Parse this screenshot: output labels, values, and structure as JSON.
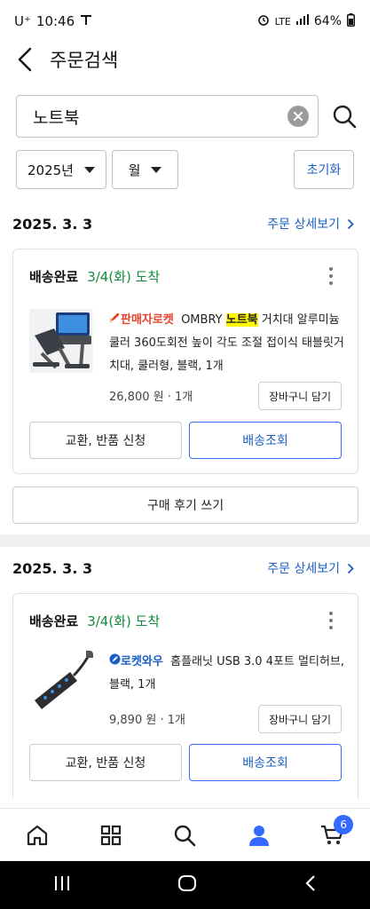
{
  "status_bar": {
    "carrier": "U⁺",
    "time": "10:46",
    "network": "LTE",
    "battery": "64%"
  },
  "header": {
    "title": "주문검색"
  },
  "search": {
    "query": "노트북"
  },
  "filters": {
    "year": "2025년",
    "month": "월",
    "reset_label": "초기화"
  },
  "orders": [
    {
      "date": "2025. 3. 3",
      "detail_label": "주문 상세보기",
      "status": "배송완료",
      "arrival": "3/4(화) 도착",
      "badge": "판매자로켓",
      "name_pre": "OMBRY ",
      "name_highlight": "노트북",
      "name_post": " 거치대 알루미늄 쿨러 360도회전 높이 각도 조절 접이식 태블릿거치대, 쿨러형, 블랙, 1개",
      "price": "26,800 원 · 1개",
      "cart_label": "장바구니 담기",
      "exchange_label": "교환, 반품 신청",
      "track_label": "배송조회"
    },
    {
      "date": "2025. 3. 3",
      "detail_label": "주문 상세보기",
      "status": "배송완료",
      "arrival": "3/4(화) 도착",
      "badge": "로켓와우",
      "name": "홈플래닛 USB 3.0 4포트 멀티허브, 블랙, 1개",
      "price": "9,890 원 · 1개",
      "cart_label": "장바구니 담기",
      "exchange_label": "교환, 반품 신청",
      "track_label": "배송조회"
    }
  ],
  "review_label": "구매 후기 쓰기",
  "bottom_nav": {
    "items": [
      "home-icon",
      "category-icon",
      "search-icon",
      "my-page-icon",
      "cart-icon"
    ],
    "cart_count": "6",
    "active_color": "#346aff"
  },
  "colors": {
    "accent": "#346aff",
    "link": "#1a5fc4",
    "success": "#128a3a",
    "rocket_red": "#e8412c"
  }
}
